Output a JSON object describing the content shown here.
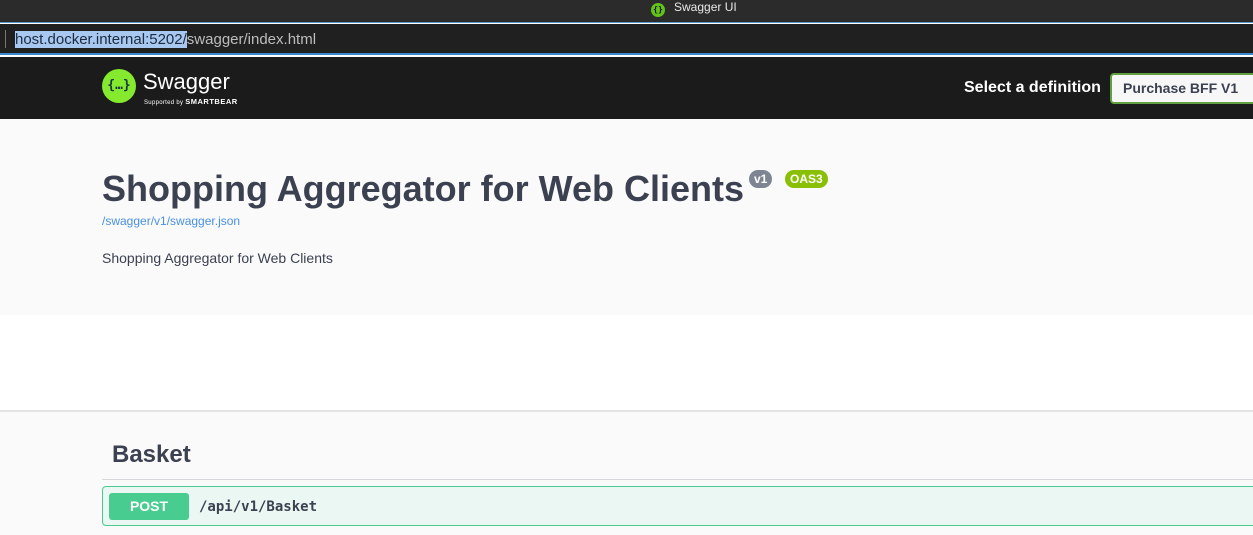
{
  "browser": {
    "window_title": "Swagger UI",
    "url_host_selected": "host.docker.internal:5202/",
    "url_path": "swagger/index.html"
  },
  "topbar": {
    "logo_name": "Swagger",
    "logo_sub_prefix": "Supported by",
    "logo_sub_brand": "SMARTBEAR",
    "logo_icon_glyph": "{…}",
    "definition_label": "Select a definition",
    "definition_selected": "Purchase BFF V1"
  },
  "info": {
    "title": "Shopping Aggregator for Web Clients",
    "version_badge": "v1",
    "oas_badge": "OAS3",
    "spec_link": "/swagger/v1/swagger.json",
    "description": "Shopping Aggregator for Web Clients"
  },
  "operations": {
    "tags": [
      {
        "name": "Basket",
        "ops": [
          {
            "method": "POST",
            "path": "/api/v1/Basket"
          }
        ]
      }
    ]
  },
  "colors": {
    "topbar_bg": "#1b1b1b",
    "swagger_green": "#85ea2d",
    "post_green": "#49cc90",
    "oas_badge": "#89bf04",
    "version_badge": "#7d8492",
    "link_blue": "#4990e2",
    "text_dark": "#3b4151"
  }
}
